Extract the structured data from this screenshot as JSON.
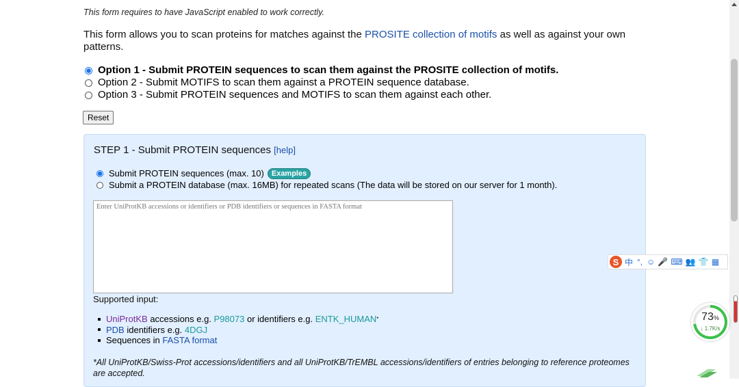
{
  "page": {
    "js_note": "This form requires to have JavaScript enabled to work correctly.",
    "intro_before": "This form allows you to scan proteins for matches against the ",
    "intro_link": "PROSITE collection of motifs",
    "intro_after": " as well as against your own patterns.",
    "options": [
      {
        "label": "Option 1 - Submit PROTEIN sequences to scan them against the PROSITE collection of motifs.",
        "selected": true
      },
      {
        "label": "Option 2 - Submit MOTIFS to scan them against a PROTEIN sequence database.",
        "selected": false
      },
      {
        "label": "Option 3 - Submit PROTEIN sequences and MOTIFS to scan them against each other.",
        "selected": false
      }
    ],
    "reset_label": "Reset"
  },
  "step1": {
    "title": "STEP 1 - Submit PROTEIN sequences ",
    "help_label": "[help]",
    "sub_options": [
      {
        "label": "Submit PROTEIN sequences (max. 10)",
        "selected": true
      },
      {
        "label": "Submit a PROTEIN database (max. 16MB) for repeated scans (The data will be stored on our server for 1 month).",
        "selected": false
      }
    ],
    "examples_label": "Examples",
    "textarea_placeholder": "Enter UniProtKB accessions or identifiers or PDB identifiers or sequences in FASTA format",
    "supported_label": "Supported input:",
    "inputs": {
      "uniprot_link": "UniProtKB",
      "uniprot_text1": " accessions e.g. ",
      "uniprot_acc": "P98073",
      "uniprot_text2": " or identifiers e.g. ",
      "uniprot_id": "ENTK_HUMAN",
      "uniprot_star": "*",
      "pdb_link": "PDB",
      "pdb_text": " identifiers e.g. ",
      "pdb_id": "4DGJ",
      "seq_text": "Sequences in ",
      "fasta_link": "FASTA format"
    },
    "footnote": "*All UniProtKB/Swiss-Prot accessions/identifiers and all UniProtKB/TrEMBL accessions/identifiers of entries belonging to reference proteomes are accepted."
  },
  "ime_toolbar": {
    "logo": "S",
    "items": [
      "中",
      "°,",
      "☺",
      "🎤",
      "⌨",
      "👥",
      "👕",
      "▦"
    ]
  },
  "speed_widget": {
    "percent": "73",
    "percent_sign": "%",
    "percent_value": 73,
    "rate": "↓ 1.7K/s"
  },
  "colors": {
    "link_blue": "#1a4fa8",
    "link_teal": "#1b9a9a",
    "link_purple": "#7a2a9a",
    "step_bg": "#e2efff",
    "radio_selected": "#1a73e8",
    "speed_green": "#3cc04a"
  }
}
